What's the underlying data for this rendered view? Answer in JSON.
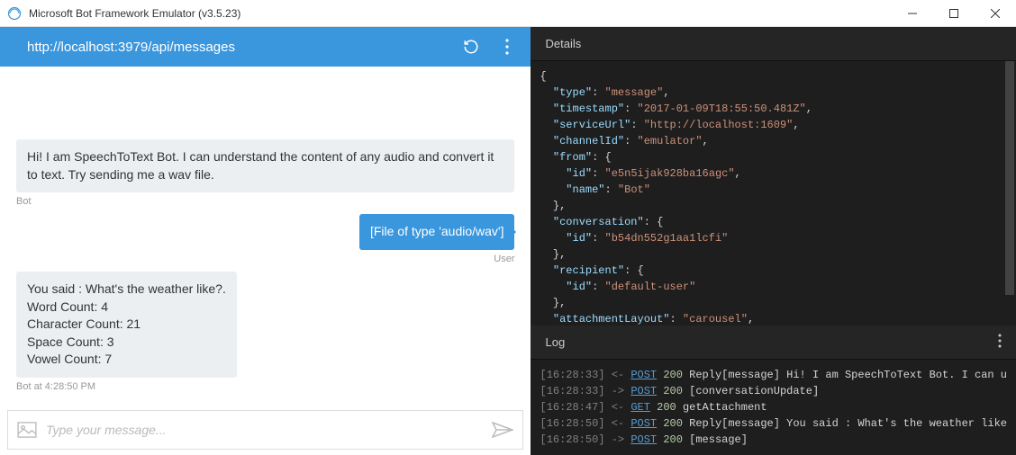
{
  "window": {
    "title": "Microsoft Bot Framework Emulator (v3.5.23)"
  },
  "addressbar": {
    "url": "http://localhost:3979/api/messages"
  },
  "chat": {
    "messages": [
      {
        "from": "bot",
        "text": "Hi! I am SpeechToText Bot. I can understand the content of any audio and convert it to text. Try sending me a wav file.",
        "sub": "Bot"
      },
      {
        "from": "user",
        "text": "[File of type 'audio/wav']",
        "sub": "User"
      },
      {
        "from": "bot",
        "text": "You said : What's the weather like?.\nWord Count: 4\nCharacter Count: 21\nSpace Count: 3\nVowel Count: 7",
        "sub": "Bot at 4:28:50 PM"
      }
    ]
  },
  "compose": {
    "placeholder": "Type your message..."
  },
  "details": {
    "title": "Details",
    "json": {
      "type": "message",
      "timestamp": "2017-01-09T18:55:50.481Z",
      "serviceUrl": "http://localhost:1609",
      "channelId": "emulator",
      "from": {
        "id": "e5n5ijak928ba16agc",
        "name": "Bot"
      },
      "conversation": {
        "id": "b54dn552g1aa1lcfi"
      },
      "recipient": {
        "id": "default-user"
      },
      "attachmentLayout": "carousel",
      "text": "",
      "attachments_note": "[ { ..."
    }
  },
  "log": {
    "title": "Log",
    "entries": [
      {
        "time": "16:28:33",
        "dir": "<-",
        "method": "POST",
        "code": "200",
        "text": "Reply[message] Hi! I am SpeechToText Bot. I can u"
      },
      {
        "time": "16:28:33",
        "dir": "->",
        "method": "POST",
        "code": "200",
        "text": "[conversationUpdate]"
      },
      {
        "time": "16:28:47",
        "dir": "<-",
        "method": "GET",
        "code": "200",
        "text": "getAttachment"
      },
      {
        "time": "16:28:50",
        "dir": "<-",
        "method": "POST",
        "code": "200",
        "text": "Reply[message] You said : What's the weather like"
      },
      {
        "time": "16:28:50",
        "dir": "->",
        "method": "POST",
        "code": "200",
        "text": "[message]"
      }
    ]
  }
}
